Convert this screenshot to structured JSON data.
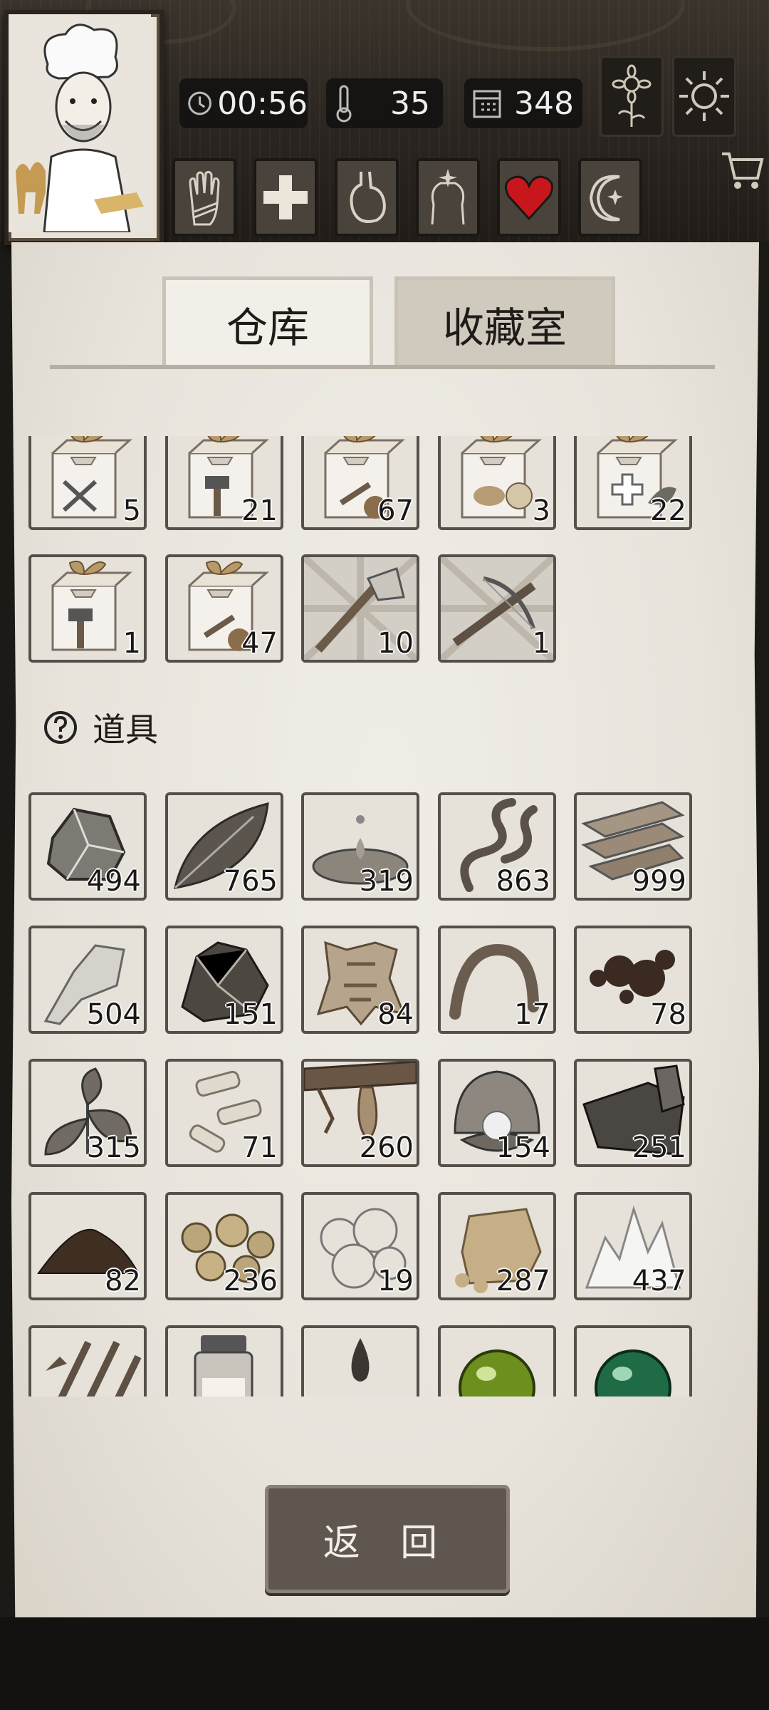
{
  "hud": {
    "time": "00:56",
    "temperature": "35",
    "days": "348"
  },
  "tabs": [
    "仓库",
    "收藏室"
  ],
  "active_tab": 0,
  "section_title": "道具",
  "return_label": "返 回",
  "crate_items": [
    {
      "icon": "crate-weapon-icon",
      "count": "5"
    },
    {
      "icon": "crate-hammer-icon",
      "count": "21"
    },
    {
      "icon": "crate-wood-icon",
      "count": "67"
    },
    {
      "icon": "crate-food-icon",
      "count": "3"
    },
    {
      "icon": "crate-medical-icon",
      "count": "22"
    },
    {
      "icon": "crate-hammer-icon",
      "count": "1"
    },
    {
      "icon": "crate-wood-icon",
      "count": "47"
    },
    {
      "icon": "stone-axe-icon",
      "count": "10"
    },
    {
      "icon": "crossbow-icon",
      "count": "1"
    }
  ],
  "prop_items": [
    {
      "icon": "stone-icon",
      "count": "494"
    },
    {
      "icon": "leaf-icon",
      "count": "765"
    },
    {
      "icon": "water-puddle-icon",
      "count": "319"
    },
    {
      "icon": "vine-icon",
      "count": "863"
    },
    {
      "icon": "wood-plank-icon",
      "count": "999"
    },
    {
      "icon": "flint-icon",
      "count": "504"
    },
    {
      "icon": "ore-icon",
      "count": "151"
    },
    {
      "icon": "animal-hide-icon",
      "count": "84"
    },
    {
      "icon": "worm-icon",
      "count": "17"
    },
    {
      "icon": "tar-icon",
      "count": "78"
    },
    {
      "icon": "herb-icon",
      "count": "315"
    },
    {
      "icon": "bone-shard-icon",
      "count": "71"
    },
    {
      "icon": "resin-branch-icon",
      "count": "260"
    },
    {
      "icon": "pearl-icon",
      "count": "154"
    },
    {
      "icon": "scrap-metal-icon",
      "count": "251"
    },
    {
      "icon": "soil-icon",
      "count": "82"
    },
    {
      "icon": "gold-nugget-icon",
      "count": "236"
    },
    {
      "icon": "wool-icon",
      "count": "19"
    },
    {
      "icon": "sandstone-icon",
      "count": "287"
    },
    {
      "icon": "salt-crystal-icon",
      "count": "437"
    },
    {
      "icon": "spear-bundle-icon",
      "count": ""
    },
    {
      "icon": "medicine-bottle-icon",
      "count": ""
    },
    {
      "icon": "drop-icon",
      "count": ""
    },
    {
      "icon": "green-orb-icon",
      "count": ""
    },
    {
      "icon": "emerald-orb-icon",
      "count": ""
    }
  ],
  "colors": {
    "paper": "#ebe7e0",
    "slot_border": "#55504a",
    "button": "#5f5650",
    "heart": "#c8161d"
  }
}
